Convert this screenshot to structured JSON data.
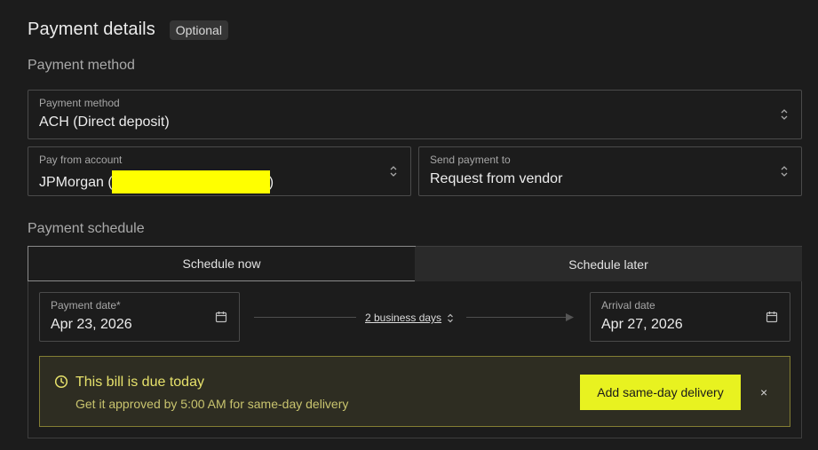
{
  "header": {
    "title": "Payment details",
    "badge": "Optional"
  },
  "method_section": {
    "label": "Payment method"
  },
  "payment_method": {
    "label": "Payment method",
    "value": "ACH (Direct deposit)"
  },
  "pay_from": {
    "label": "Pay from account",
    "value_prefix": "JPMorgan (",
    "value_suffix": ")"
  },
  "send_to": {
    "label": "Send payment to",
    "value": "Request from vendor"
  },
  "schedule_section": {
    "label": "Payment schedule"
  },
  "tabs": [
    {
      "label": "Schedule now",
      "active": true
    },
    {
      "label": "Schedule later",
      "active": false
    }
  ],
  "payment_date": {
    "label": "Payment date*",
    "value": "Apr 23, 2026"
  },
  "transit": {
    "label": "2 business days"
  },
  "arrival_date": {
    "label": "Arrival date",
    "value": "Apr 27, 2026"
  },
  "alert": {
    "title": "This bill is due today",
    "subtitle": "Get it approved by 5:00 AM for same-day delivery",
    "cta": "Add same-day delivery",
    "close": "×"
  },
  "colors": {
    "background": "#1c1c1c",
    "accent": "#e8f220",
    "alert_text": "#e6e16b",
    "redaction": "#ffff00"
  }
}
